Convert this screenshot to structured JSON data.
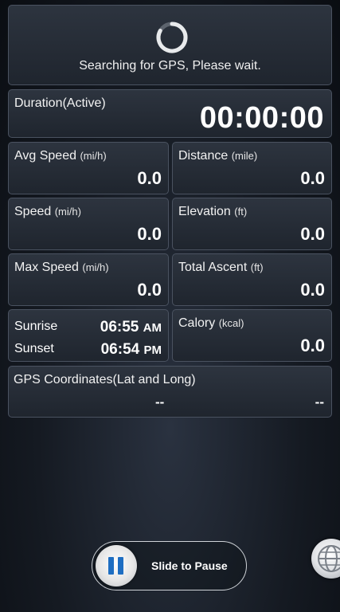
{
  "gps": {
    "status_text": "Searching for GPS, Please wait."
  },
  "duration": {
    "label": "Duration(Active)",
    "value": "00:00:00"
  },
  "avg_speed": {
    "label": "Avg Speed",
    "unit": "(mi/h)",
    "value": "0.0"
  },
  "distance": {
    "label": "Distance",
    "unit": "(mile)",
    "value": "0.0"
  },
  "speed": {
    "label": "Speed",
    "unit": "(mi/h)",
    "value": "0.0"
  },
  "elevation": {
    "label": "Elevation",
    "unit": "(ft)",
    "value": "0.0"
  },
  "max_speed": {
    "label": "Max Speed",
    "unit": "(mi/h)",
    "value": "0.0"
  },
  "total_ascent": {
    "label": "Total Ascent",
    "unit": "(ft)",
    "value": "0.0"
  },
  "sun": {
    "sunrise_label": "Sunrise",
    "sunrise_time": "06:55",
    "sunrise_ampm": "AM",
    "sunset_label": "Sunset",
    "sunset_time": "06:54",
    "sunset_ampm": "PM"
  },
  "calory": {
    "label": "Calory",
    "unit": "(kcal)",
    "value": "0.0"
  },
  "coordinates": {
    "label": "GPS Coordinates(Lat and Long)",
    "lat": "--",
    "long": "--"
  },
  "controls": {
    "slide_label": "Slide to Pause"
  },
  "icons": {
    "spinner": "loading-spinner-icon",
    "pause": "pause-icon",
    "globe": "globe-icon"
  }
}
